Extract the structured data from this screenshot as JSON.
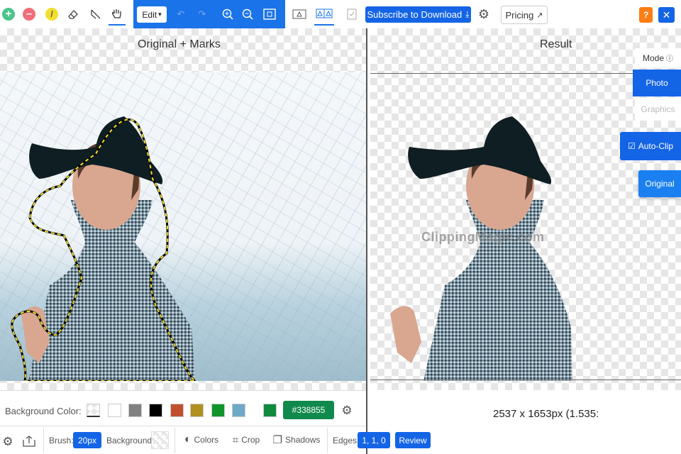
{
  "toolbar": {
    "edit_label": "Edit",
    "subscribe_label": "Subscribe to Download",
    "pricing_label": "Pricing",
    "help_label": "?",
    "close_label": "✕"
  },
  "panes": {
    "left_title": "Original + Marks",
    "right_title": "Result",
    "watermark": "ClippingMagic.com",
    "dimensions_text": "2537 x 1653px (1.535:"
  },
  "side": {
    "mode_label": "Mode",
    "photo_label": "Photo",
    "graphics_label": "Graphics",
    "autoclip_label": "Auto-Clip",
    "original_label": "Original"
  },
  "bottom": {
    "bg_color_label": "Background Color:",
    "color_hex": "#338855",
    "brush_label": "Brush:",
    "brush_value": "20px",
    "background_label": "Background:",
    "colors_label": "Colors",
    "crop_label": "Crop",
    "shadows_label": "Shadows",
    "edges_label": "Edges:",
    "edges_value": "1, 1, 0",
    "review_label": "Review"
  },
  "swatches": [
    "#ffffff",
    "#808080",
    "#000000",
    "#c0502e",
    "#b09020",
    "#10952a",
    "#70a8c8"
  ],
  "current_swatch": "#108a3c",
  "colors": {
    "accent": "#1464e6",
    "orange": "#fd7e14",
    "green_add": "#4cc48a",
    "red_remove": "#f06e7a",
    "yellow_mark": "#f2de2e"
  }
}
